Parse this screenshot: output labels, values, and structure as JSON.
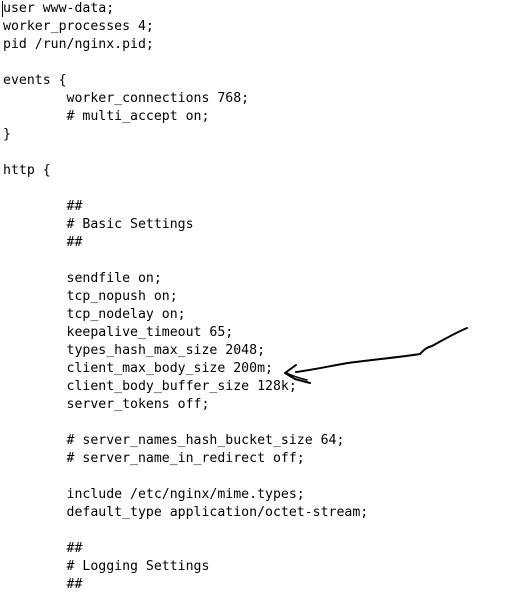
{
  "editor": {
    "lines": [
      "user www-data;",
      "worker_processes 4;",
      "pid /run/nginx.pid;",
      "",
      "events {",
      "        worker_connections 768;",
      "        # multi_accept on;",
      "}",
      "",
      "http {",
      "",
      "        ##",
      "        # Basic Settings",
      "        ##",
      "",
      "        sendfile on;",
      "        tcp_nopush on;",
      "        tcp_nodelay on;",
      "        keepalive_timeout 65;",
      "        types_hash_max_size 2048;",
      "        client_max_body_size 200m;",
      "        client_body_buffer_size 128k;",
      "        server_tokens off;",
      "",
      "        # server_names_hash_bucket_size 64;",
      "        # server_name_in_redirect off;",
      "",
      "        include /etc/nginx/mime.types;",
      "        default_type application/octet-stream;",
      "",
      "        ##",
      "        # Logging Settings",
      "        ##"
    ]
  },
  "annotation": {
    "icon": "hand-drawn-arrow-icon",
    "color": "#000000"
  }
}
